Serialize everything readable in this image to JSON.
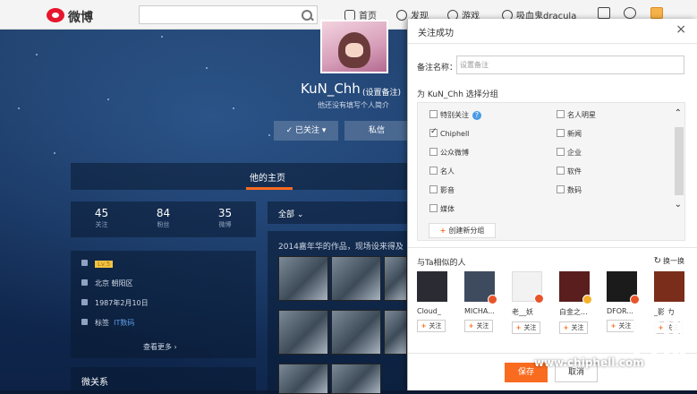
{
  "header": {
    "logo_text": "微博",
    "nav": [
      {
        "label": "首页",
        "icon": "home-icon"
      },
      {
        "label": "发现",
        "icon": "compass-icon"
      },
      {
        "label": "游戏",
        "icon": "game-icon"
      },
      {
        "label": "吸血鬼dracula",
        "icon": "user-icon"
      }
    ]
  },
  "profile": {
    "name": "KuN_Chh",
    "remark_link": "(设置备注)",
    "bio": "他还没有填写个人简介",
    "followed_label": "✓ 已关注 ▾",
    "message_label": "私信",
    "home_tab": "他的主页",
    "stats": [
      {
        "value": "45",
        "label": "关注"
      },
      {
        "value": "84",
        "label": "粉丝"
      },
      {
        "value": "35",
        "label": "微博"
      }
    ],
    "level": "Lv.5",
    "location": "北京 朝阳区",
    "birthday": "1987年2月10日",
    "tag_prefix": "标签",
    "tag": "IT数码",
    "more": "查看更多 ›",
    "relation_title": "微关系"
  },
  "feed": {
    "filter": "全部 ⌄",
    "text": "2014嘉年华的作品，现场设来得及"
  },
  "modal": {
    "title": "关注成功",
    "close": "×",
    "remark_label": "备注名称：",
    "remark_placeholder": "设置备注",
    "group_title": "为 KuN_Chh 选择分组",
    "groups": [
      {
        "label": "特别关注",
        "checked": false,
        "help": true
      },
      {
        "label": "名人明星",
        "checked": false
      },
      {
        "label": "Chiphell",
        "checked": true
      },
      {
        "label": "新闻",
        "checked": false
      },
      {
        "label": "公众微博",
        "checked": false
      },
      {
        "label": "企业",
        "checked": false
      },
      {
        "label": "名人",
        "checked": false
      },
      {
        "label": "软件",
        "checked": false
      },
      {
        "label": "影音",
        "checked": false
      },
      {
        "label": "数码",
        "checked": false
      },
      {
        "label": "媒体",
        "checked": false
      }
    ],
    "help_glyph": "?",
    "create_group": "创建新分组",
    "similar_title": "与Ta相似的人",
    "refresh": "换一换",
    "people": [
      {
        "name": "Cloud_",
        "follow": "关注",
        "badge": "none",
        "color": "#2b2b33"
      },
      {
        "name": "MICHA...",
        "follow": "关注",
        "badge": "red",
        "color": "#3e4b5e"
      },
      {
        "name": "老__妖",
        "follow": "关注",
        "badge": "red",
        "color": "#f2f2f2"
      },
      {
        "name": "白金之...",
        "follow": "关注",
        "badge": "gold",
        "color": "#5a1e1e"
      },
      {
        "name": "DFOR...",
        "follow": "关注",
        "badge": "red",
        "color": "#1b1b1b"
      },
      {
        "name": "_影·力",
        "follow": "关注",
        "badge": "none",
        "color": "#7a2d1a"
      }
    ],
    "save": "保存",
    "cancel": "取消"
  },
  "watermark": {
    "url": "www.chiphell.com"
  }
}
